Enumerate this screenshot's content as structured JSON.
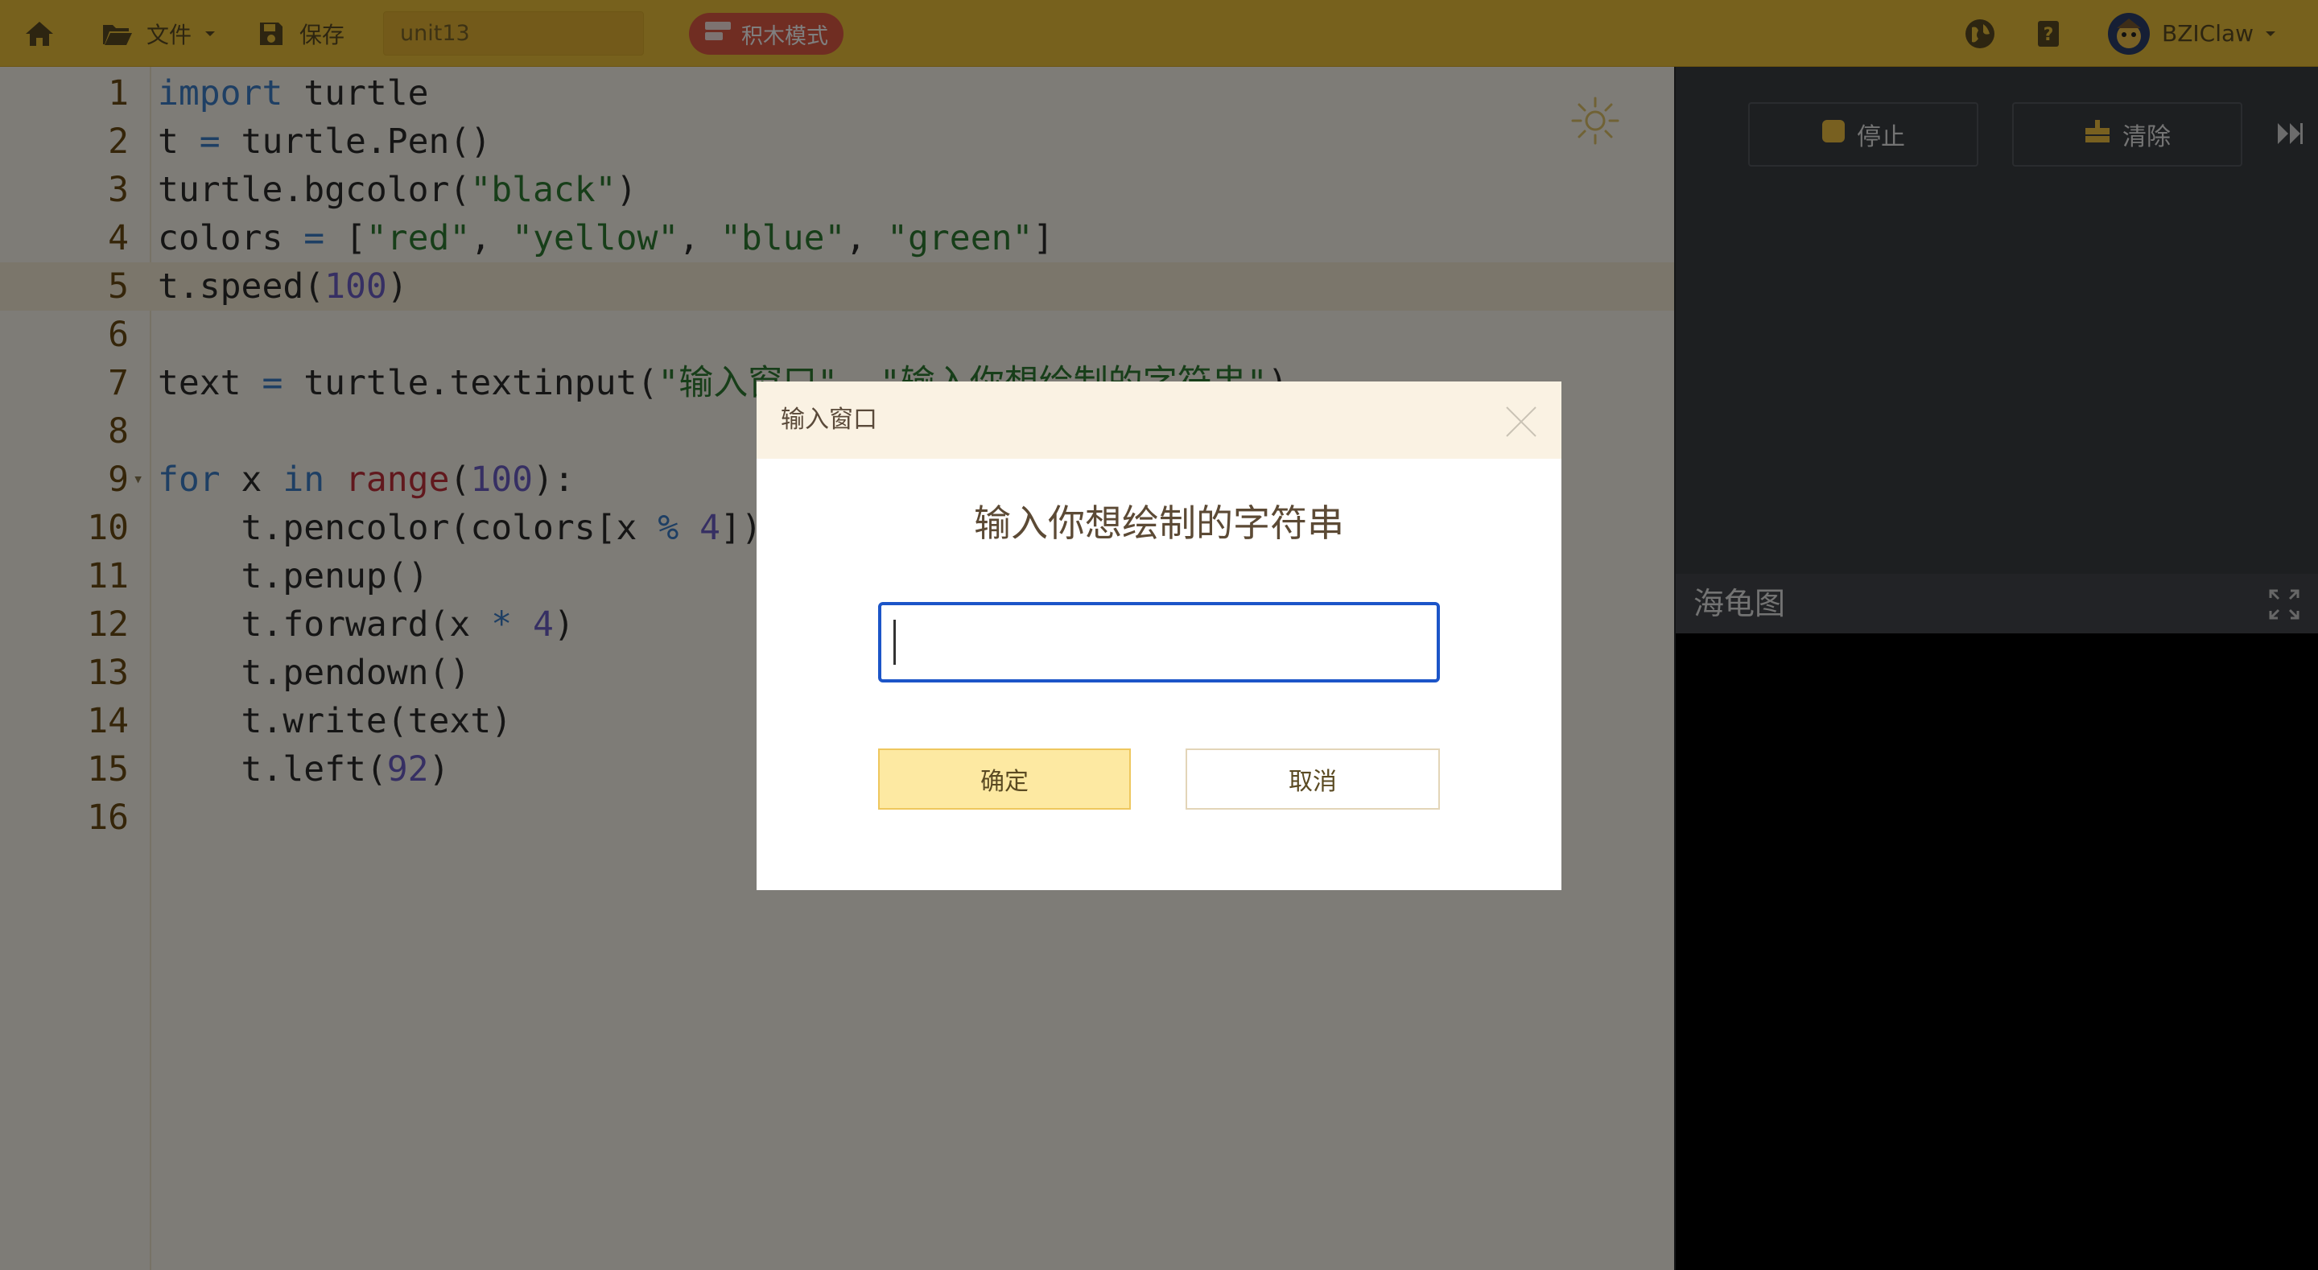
{
  "toolbar": {
    "file_label": "文件",
    "save_label": "保存",
    "filename": "unit13",
    "block_mode_label": "积木模式",
    "user_name": "BZIClaw"
  },
  "editor": {
    "lines": [
      {
        "n": "1",
        "code": "import turtle"
      },
      {
        "n": "2",
        "code": "t = turtle.Pen()"
      },
      {
        "n": "3",
        "code": "turtle.bgcolor(\"black\")"
      },
      {
        "n": "4",
        "code": "colors = [\"red\", \"yellow\", \"blue\", \"green\"]"
      },
      {
        "n": "5",
        "code": "t.speed(100)"
      },
      {
        "n": "6",
        "code": ""
      },
      {
        "n": "7",
        "code": "text = turtle.textinput(\"输入窗口\", \"输入你想绘制的字符串\")"
      },
      {
        "n": "8",
        "code": ""
      },
      {
        "n": "9",
        "code": "for x in range(100):"
      },
      {
        "n": "10",
        "code": "    t.pencolor(colors[x % 4])"
      },
      {
        "n": "11",
        "code": "    t.penup()"
      },
      {
        "n": "12",
        "code": "    t.forward(x * 4)"
      },
      {
        "n": "13",
        "code": "    t.pendown()"
      },
      {
        "n": "14",
        "code": "    t.write(text)"
      },
      {
        "n": "15",
        "code": "    t.left(92)"
      },
      {
        "n": "16",
        "code": ""
      }
    ],
    "active_line": 5
  },
  "right_panel": {
    "stop_label": "停止",
    "clear_label": "清除",
    "turtle_title": "海龟图"
  },
  "dialog": {
    "title": "输入窗口",
    "prompt": "输入你想绘制的字符串",
    "input_value": "",
    "ok_label": "确定",
    "cancel_label": "取消"
  },
  "colors": {
    "topbar": "#efc23a",
    "block_mode": "#e05a45",
    "input_focus": "#1c55c8",
    "ok_button": "#fde9a2"
  }
}
